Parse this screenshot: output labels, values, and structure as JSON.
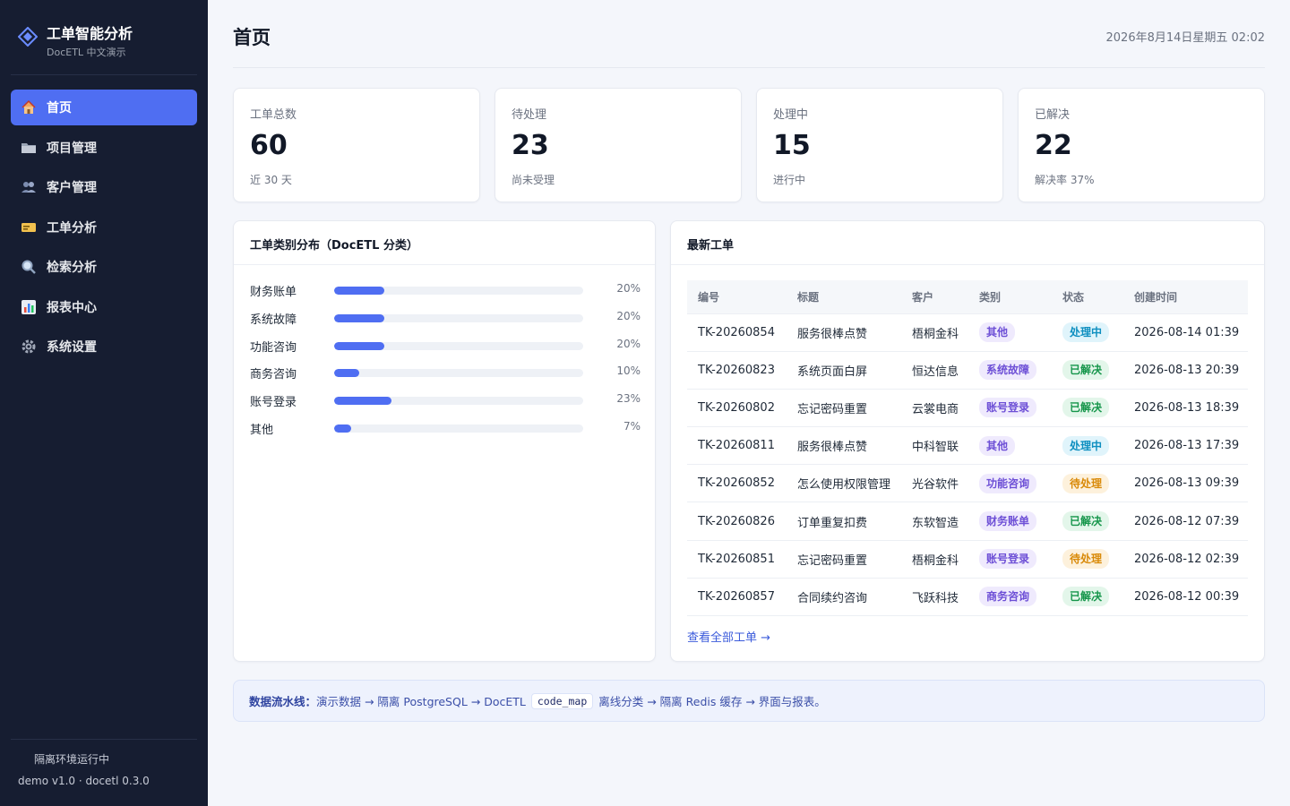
{
  "brand": {
    "title": "工单智能分析",
    "subtitle": "DocETL 中文演示",
    "logo_icon": "diamond-icon",
    "accent": "#4f6ef2"
  },
  "nav": {
    "items": [
      {
        "label": "首页",
        "icon": "home-icon",
        "active": true
      },
      {
        "label": "项目管理",
        "icon": "folder-icon",
        "active": false
      },
      {
        "label": "客户管理",
        "icon": "users-icon",
        "active": false
      },
      {
        "label": "工单分析",
        "icon": "ticket-icon",
        "active": false
      },
      {
        "label": "检索分析",
        "icon": "search-icon",
        "active": false
      },
      {
        "label": "报表中心",
        "icon": "chart-icon",
        "active": false
      },
      {
        "label": "系统设置",
        "icon": "gear-icon",
        "active": false
      }
    ]
  },
  "footer": {
    "env_status": "隔离环境运行中",
    "version": "demo v1.0 · docetl 0.3.0"
  },
  "header": {
    "title": "首页",
    "datetime": "2026年8月14日星期五 02:02"
  },
  "stats": [
    {
      "label": "工单总数",
      "value": "60",
      "sub": "近 30 天"
    },
    {
      "label": "待处理",
      "value": "23",
      "sub": "尚未受理"
    },
    {
      "label": "处理中",
      "value": "15",
      "sub": "进行中"
    },
    {
      "label": "已解决",
      "value": "22",
      "sub": "解决率 37%"
    }
  ],
  "category_panel": {
    "title": "工单类别分布（DocETL 分类）",
    "items": [
      {
        "name": "财务账单",
        "pct_label": "20%",
        "fraction": 0.2
      },
      {
        "name": "系统故障",
        "pct_label": "20%",
        "fraction": 0.2
      },
      {
        "name": "功能咨询",
        "pct_label": "20%",
        "fraction": 0.2
      },
      {
        "name": "商务咨询",
        "pct_label": "10%",
        "fraction": 0.1
      },
      {
        "name": "账号登录",
        "pct_label": "23%",
        "fraction": 0.23
      },
      {
        "name": "其他",
        "pct_label": "7%",
        "fraction": 0.07
      }
    ]
  },
  "tickets_panel": {
    "title": "最新工单",
    "columns": [
      "编号",
      "标题",
      "客户",
      "类别",
      "状态",
      "创建时间"
    ],
    "rows": [
      {
        "id": "TK-20260854",
        "title": "服务很棒点赞",
        "customer": "梧桐金科",
        "category": "其他",
        "status": "处理中",
        "status_kind": "processing",
        "created": "2026-08-14 01:39"
      },
      {
        "id": "TK-20260823",
        "title": "系统页面白屏",
        "customer": "恒达信息",
        "category": "系统故障",
        "status": "已解决",
        "status_kind": "resolved",
        "created": "2026-08-13 20:39"
      },
      {
        "id": "TK-20260802",
        "title": "忘记密码重置",
        "customer": "云裳电商",
        "category": "账号登录",
        "status": "已解决",
        "status_kind": "resolved",
        "created": "2026-08-13 18:39"
      },
      {
        "id": "TK-20260811",
        "title": "服务很棒点赞",
        "customer": "中科智联",
        "category": "其他",
        "status": "处理中",
        "status_kind": "processing",
        "created": "2026-08-13 17:39"
      },
      {
        "id": "TK-20260852",
        "title": "怎么使用权限管理",
        "customer": "光谷软件",
        "category": "功能咨询",
        "status": "待处理",
        "status_kind": "pending",
        "created": "2026-08-13 09:39"
      },
      {
        "id": "TK-20260826",
        "title": "订单重复扣费",
        "customer": "东软智造",
        "category": "财务账单",
        "status": "已解决",
        "status_kind": "resolved",
        "created": "2026-08-12 07:39"
      },
      {
        "id": "TK-20260851",
        "title": "忘记密码重置",
        "customer": "梧桐金科",
        "category": "账号登录",
        "status": "待处理",
        "status_kind": "pending",
        "created": "2026-08-12 02:39"
      },
      {
        "id": "TK-20260857",
        "title": "合同续约咨询",
        "customer": "飞跃科技",
        "category": "商务咨询",
        "status": "已解决",
        "status_kind": "resolved",
        "created": "2026-08-12 00:39"
      }
    ],
    "view_all": "查看全部工单 →"
  },
  "pipeline": {
    "label": "数据流水线：",
    "text_before": "演示数据 → 隔离 PostgreSQL → DocETL",
    "code": "code_map",
    "text_after": "离线分类 → 隔离 Redis 缓存 → 界面与报表。"
  },
  "colors": {
    "sidebar_bg": "#161d31",
    "status_processing": "#0e8fc0",
    "status_resolved": "#16964b",
    "status_pending": "#d98a09",
    "category_badge": "#6d4fd6"
  }
}
